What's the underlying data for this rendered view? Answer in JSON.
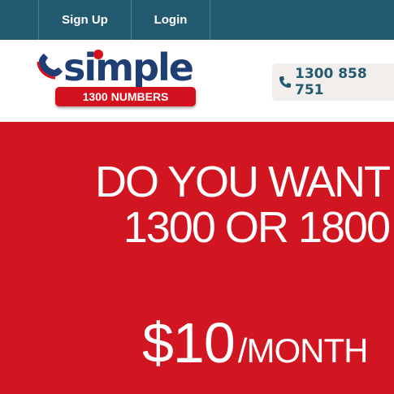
{
  "nav": {
    "items": [
      {
        "label": "Sign Up"
      },
      {
        "label": "Login"
      }
    ]
  },
  "logo": {
    "word": "simple",
    "badge": "1300 NUMBERS",
    "colors": {
      "navy": "#1f3e74",
      "red": "#d4111e"
    }
  },
  "contact": {
    "icon": "phone-icon",
    "phone": "1300 858 751"
  },
  "hero": {
    "title_line1": "DO YOU WANT",
    "title_line2": "1300 OR 1800",
    "price": "$10",
    "price_unit": "/MONTH",
    "background": "#d11622"
  },
  "colors": {
    "topbar": "#235a70",
    "accent": "#d11622"
  }
}
